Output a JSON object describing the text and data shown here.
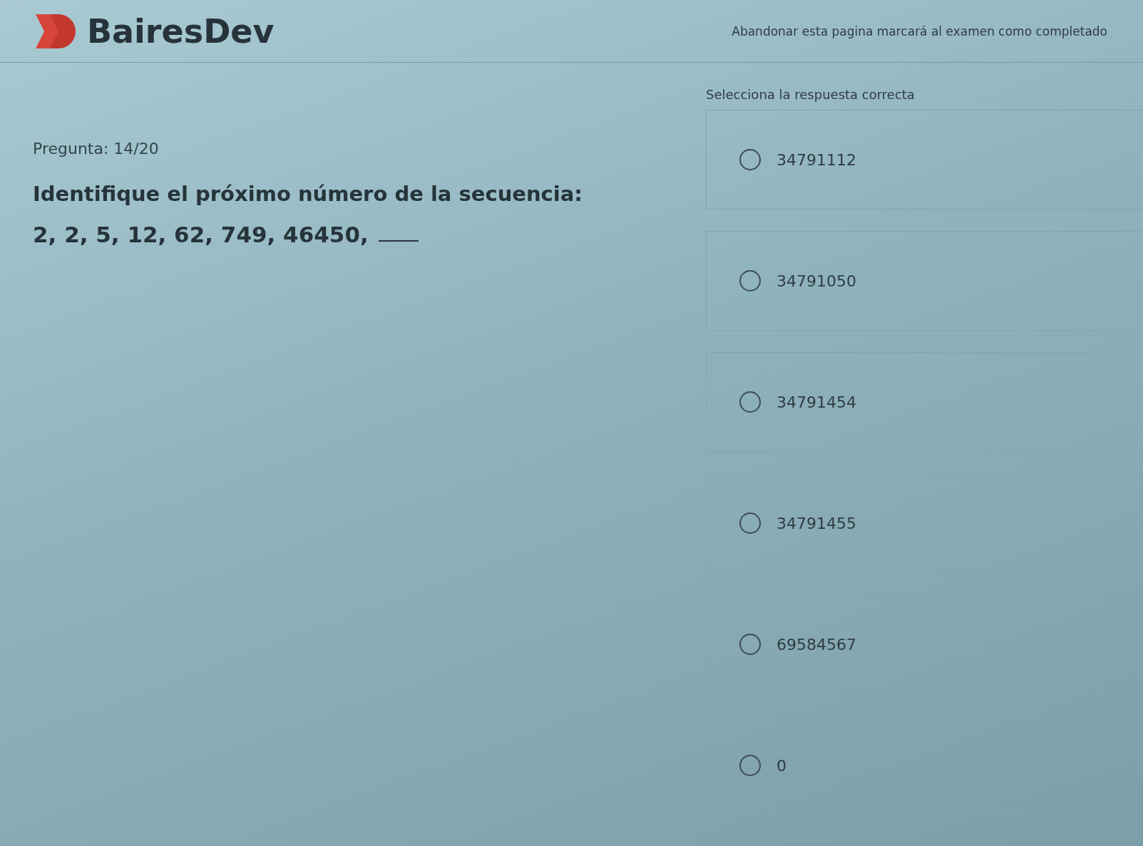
{
  "header": {
    "logo": "BairesDev",
    "warning": "Abandonar esta pagina marcará al examen como completado"
  },
  "instruction": "Selecciona la respuesta correcta",
  "question": {
    "counter": "Pregunta: 14/20",
    "title": "Identifique el próximo número de la secuencia:",
    "sequence": "2, 2, 5, 12, 62, 749, 46450,"
  },
  "options": [
    {
      "label": "34791112",
      "selected": false
    },
    {
      "label": "34791050",
      "selected": false
    },
    {
      "label": "34791454",
      "selected": false
    },
    {
      "label": "34791455",
      "selected": false
    },
    {
      "label": "69584567",
      "selected": false
    },
    {
      "label": "0",
      "selected": false
    }
  ]
}
